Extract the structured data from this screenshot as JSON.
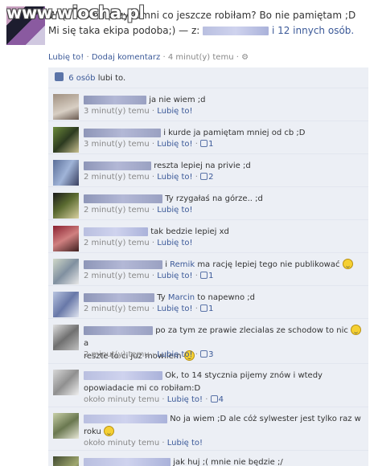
{
  "watermark": "www.wiocha.pl",
  "post": {
    "line1": "Więc kto mi przypomni co jeszcze robiłam? Bo nie pamiętam ;D",
    "line2_start": "Mi się taka ekipa podoba;) — z:",
    "line2_end": "i 12 innych osób.",
    "actions": {
      "like": "Lubię to!",
      "sep1": "·",
      "comment": "Dodaj komentarz",
      "sep2": "·",
      "time": "4 minut(y) temu",
      "sep3": "·"
    }
  },
  "likes": {
    "count_link": "6 osób",
    "suffix": "lubi to."
  },
  "comments": [
    {
      "text": "ja nie wiem ;d",
      "time": "3 minut(y) temu",
      "like": "Lubię to!",
      "likes": ""
    },
    {
      "text": "i kurde ja pamiętam mniej od cb ;D",
      "time": "3 minut(y) temu",
      "like": "Lubię to!",
      "likes": "1"
    },
    {
      "text": "reszta lepiej na privie ;d",
      "time": "2 minut(y) temu",
      "like": "Lubię to!",
      "likes": "2"
    },
    {
      "text": "Ty rzygałaś na górze.. ;d",
      "time": "2 minut(y) temu",
      "like": "Lubię to!",
      "likes": ""
    },
    {
      "text": "tak bedzie lepiej xd",
      "time": "2 minut(y) temu",
      "like": "Lubię to!",
      "likes": ""
    },
    {
      "text_pre": "i",
      "mention": "Remik",
      "text": "ma rację lepiej tego nie publikować",
      "time": "2 minut(y) temu",
      "like": "Lubię to!",
      "likes": "1"
    },
    {
      "text_pre": "Ty",
      "mention": "Marcin",
      "text": "to napewno ;d",
      "time": "2 minut(y) temu",
      "like": "Lubię to!",
      "likes": "1"
    },
    {
      "text": "po za tym ze prawie zlecialas ze schodow to nic",
      "text2_pre": "a",
      "text2": "reszte to ci juz mowilem",
      "time": "2 minut(y) temu",
      "like": "Lubię to!",
      "likes": "3"
    },
    {
      "text": "Ok, to 14 stycznia pijemy znów i wtedy",
      "text2": "opowiadacie mi co robiłam:D",
      "time": "około minuty temu",
      "like": "Lubię to!",
      "likes": "4"
    },
    {
      "text": "No ja wiem ;D ale cóż sylwester jest tylko raz w",
      "text2": "roku",
      "time": "około minuty temu",
      "like": "Lubię to!",
      "likes": ""
    },
    {
      "text": "jak huj ;( mnie nie będzie ;/",
      "time": "",
      "like": "",
      "likes": ""
    }
  ],
  "dot": "·",
  "colors": {
    "link": "#3b5998",
    "comment_bg": "#eceff5",
    "meta": "#888888"
  }
}
